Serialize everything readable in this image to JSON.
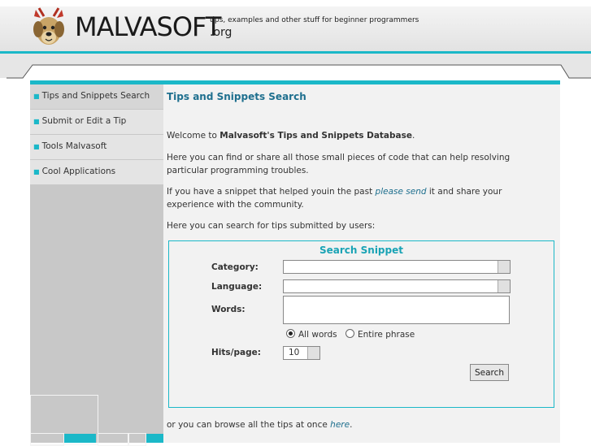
{
  "header": {
    "logo_text": "MALVASOFT",
    "logo_suffix": ".org",
    "tagline": "tips, examples and other stuff for beginner programmers"
  },
  "sidebar": {
    "items": [
      {
        "label": "Tips and Snippets Search"
      },
      {
        "label": "Submit or Edit a Tip"
      },
      {
        "label": "Tools Malvasoft"
      },
      {
        "label": "Cool Applications"
      }
    ]
  },
  "main": {
    "title": "Tips and Snippets Search",
    "welcome_prefix": "Welcome to ",
    "welcome_bold": "Malvasoft's Tips and Snippets Database",
    "welcome_suffix": ".",
    "intro": "Here you can find or share all those small pieces of code that can help resolving particular programming troubles.",
    "send_prefix": "If you have a snippet that helped youin the past ",
    "send_link": "please send",
    "send_suffix": " it and share your experience with the community.",
    "search_intro": "Here you can search for tips submitted by users:",
    "browse_prefix": "or you can browse all the tips at once ",
    "browse_link": "here",
    "browse_suffix": "."
  },
  "search_form": {
    "title": "Search Snippet",
    "category_label": "Category:",
    "category_value": "",
    "language_label": "Language:",
    "language_value": "",
    "words_label": "Words:",
    "words_value": "",
    "radio_all": "All words",
    "radio_phrase": "Entire phrase",
    "radio_selected": "All words",
    "hits_label": "Hits/page:",
    "hits_value": "10",
    "search_button": "Search"
  },
  "colors": {
    "accent": "#1bb8c8",
    "link": "#1e6f8e",
    "sidebar_bg": "#c8c8c8",
    "content_bg": "#f2f2f2"
  }
}
